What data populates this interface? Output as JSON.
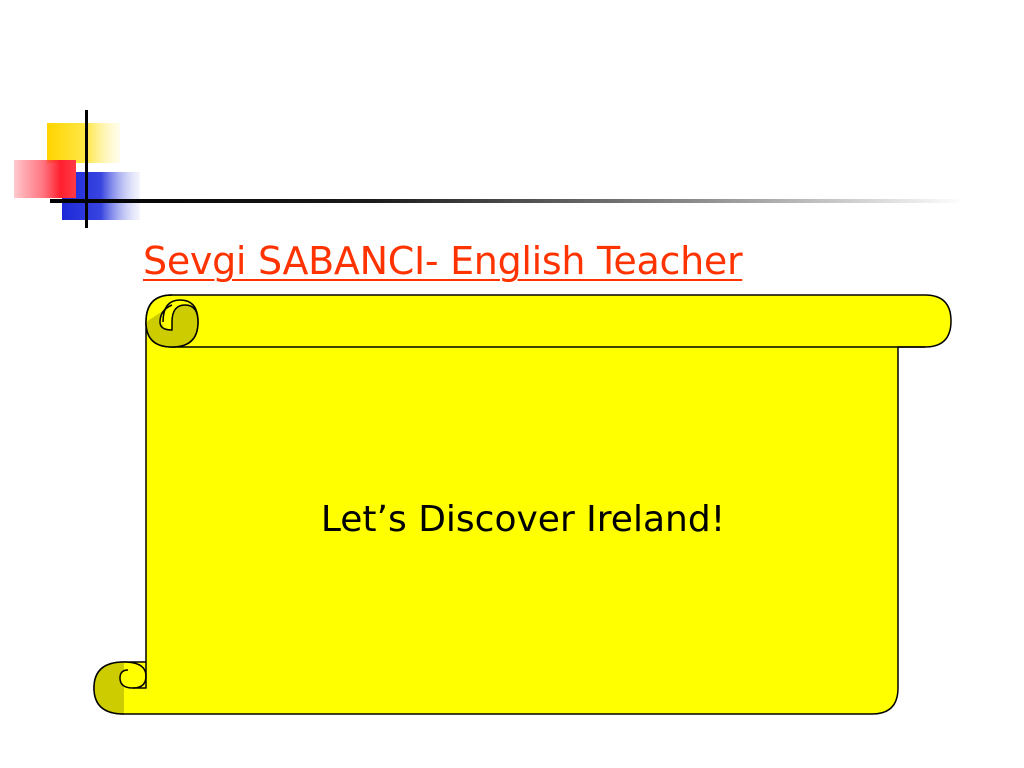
{
  "slide": {
    "title": "Sevgi SABANCI- English Teacher",
    "scroll_text": "Let’s Discover Ireland!"
  },
  "colors": {
    "title": "#ff3300",
    "scroll_fill": "#ffff00",
    "scroll_outline": "#000000",
    "deco_yellow": "#ffd700",
    "deco_red": "#ff3344",
    "deco_blue": "#2233dd",
    "deco_line": "#000000"
  },
  "icons": {
    "corner_decoration": "color-squares-crosshair-icon",
    "scroll_shape": "scroll-banner-icon"
  }
}
